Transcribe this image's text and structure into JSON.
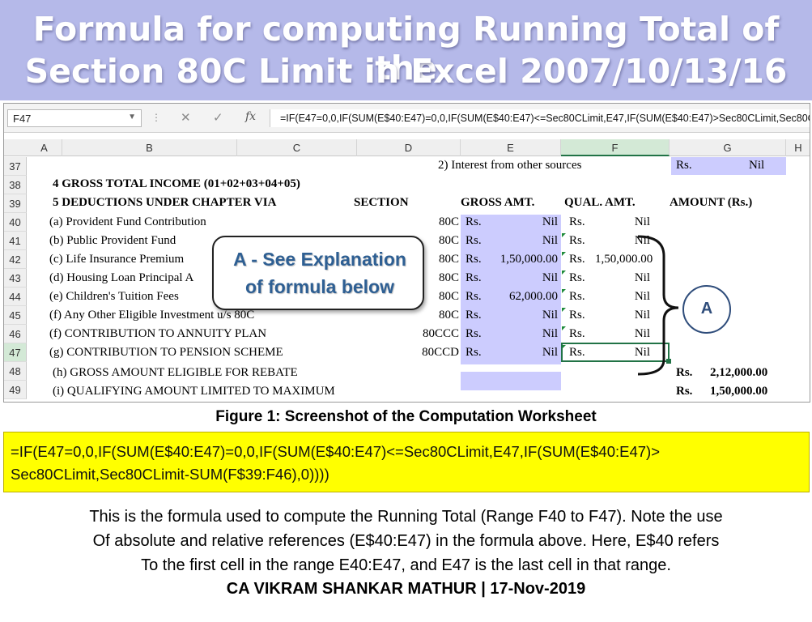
{
  "banner": {
    "line1": "Formula for computing Running Total of the",
    "line2": "Section 80C Limit in Excel 2007/10/13/16"
  },
  "excel": {
    "name_box": "F47",
    "fx_label": "fx",
    "formula": "=IF(E47=0,0,IF(SUM(E$40:E47)=0,0,IF(SUM(E$40:E47)<=Sec80CLimit,E47,IF(SUM(E$40:E47)>Sec80CLimit,Sec80CLimit-SUM(F$39:F46),0))))",
    "columns": [
      "A",
      "B",
      "C",
      "D",
      "E",
      "F",
      "G",
      "H"
    ],
    "rows": [
      "37",
      "38",
      "39",
      "40",
      "41",
      "42",
      "43",
      "44",
      "45",
      "46",
      "47",
      "48",
      "49"
    ],
    "cells": {
      "e37": "2) Interest from other sources",
      "g37a": "Rs.",
      "g37b": "Nil",
      "b38": "4  GROSS TOTAL INCOME (01+02+03+04+05)",
      "b39": "5  DEDUCTIONS UNDER CHAPTER VIA",
      "d39": "SECTION",
      "e39": "GROSS AMT.",
      "f39": "QUAL. AMT.",
      "g39": "AMOUNT (Rs.)",
      "items": [
        {
          "desc": "(a) Provident Fund Contribution",
          "sec": "80C",
          "e_rs": "Rs.",
          "e_val": "Nil",
          "f_rs": "Rs.",
          "f_val": "Nil"
        },
        {
          "desc": "(b) Public Provident Fund",
          "sec": "80C",
          "e_rs": "Rs.",
          "e_val": "Nil",
          "f_rs": "Rs.",
          "f_val": "Nil"
        },
        {
          "desc": "(c) Life Insurance Premium",
          "sec": "80C",
          "e_rs": "Rs.",
          "e_val": "1,50,000.00",
          "f_rs": "Rs.",
          "f_val": "1,50,000.00"
        },
        {
          "desc": "(d) Housing Loan Principal A",
          "sec": "80C",
          "e_rs": "Rs.",
          "e_val": "Nil",
          "f_rs": "Rs.",
          "f_val": "Nil"
        },
        {
          "desc": "(e) Children's Tuition Fees",
          "sec": "80C",
          "e_rs": "Rs.",
          "e_val": "62,000.00",
          "f_rs": "Rs.",
          "f_val": "Nil"
        },
        {
          "desc": "(f) Any Other Eligible Investment u/s 80C",
          "sec": "80C",
          "e_rs": "Rs.",
          "e_val": "Nil",
          "f_rs": "Rs.",
          "f_val": "Nil"
        },
        {
          "desc": "(f) CONTRIBUTION TO ANNUITY PLAN",
          "sec": "80CCC",
          "e_rs": "Rs.",
          "e_val": "Nil",
          "f_rs": "Rs.",
          "f_val": "Nil"
        },
        {
          "desc": "(g) CONTRIBUTION TO PENSION SCHEME",
          "sec": "80CCD",
          "e_rs": "Rs.",
          "e_val": "Nil",
          "f_rs": "Rs.",
          "f_val": "Nil"
        }
      ],
      "b48": "(h) GROSS AMOUNT ELIGIBLE FOR REBATE",
      "g48a": "Rs.",
      "g48b": "2,12,000.00",
      "b49": "(i) QUALIFYING AMOUNT LIMITED TO MAXIMUM",
      "g49a": "Rs.",
      "g49b": "1,50,000.00"
    },
    "callout_line1": "A - See Explanation",
    "callout_line2": "of formula below",
    "marker_label": "A"
  },
  "caption": "Figure 1: Screenshot of the Computation Worksheet",
  "formula_box": {
    "line1": "=IF(E47=0,0,IF(SUM(E$40:E47)=0,0,IF(SUM(E$40:E47)<=Sec80CLimit,E47,IF(SUM(E$40:E47)>",
    "line2": "Sec80CLimit,Sec80CLimit-SUM(F$39:F46),0))))"
  },
  "explanation": [
    "This is the formula used to compute the Running Total (Range F40 to F47). Note the use",
    "Of absolute and relative references (E$40:E47) in the formula above. Here, E$40 refers",
    "To the first cell in the range E40:E47, and E47 is the last cell in that range."
  ],
  "credit": "CA VIKRAM SHANKAR MATHUR | 17-Nov-2019",
  "colors": {
    "banner": "#b5b9e9",
    "input_shade": "#ccccfe",
    "formula_box": "#ffff00",
    "selection": "#217346"
  }
}
